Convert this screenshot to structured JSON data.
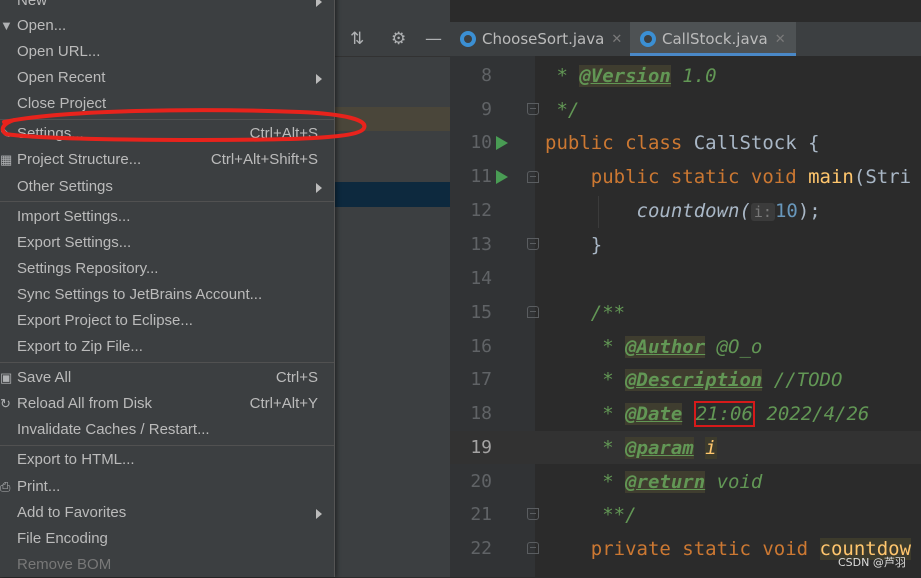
{
  "file_menu": {
    "items": [
      {
        "label": "New",
        "shortcut": "",
        "submenu": true,
        "disabled": false,
        "icon": ""
      },
      {
        "label": "Open...",
        "shortcut": "",
        "submenu": false,
        "disabled": false,
        "icon": "folder-icon"
      },
      {
        "label": "Open URL...",
        "shortcut": "",
        "submenu": false,
        "disabled": false,
        "icon": ""
      },
      {
        "label": "Open Recent",
        "shortcut": "",
        "submenu": true,
        "disabled": false,
        "icon": ""
      },
      {
        "label": "Close Project",
        "shortcut": "",
        "submenu": false,
        "disabled": false,
        "icon": ""
      },
      {
        "label": "Settings...",
        "shortcut": "Ctrl+Alt+S",
        "submenu": false,
        "disabled": false,
        "icon": "wrench-icon"
      },
      {
        "label": "Project Structure...",
        "shortcut": "Ctrl+Alt+Shift+S",
        "submenu": false,
        "disabled": false,
        "icon": "project-structure-icon"
      },
      {
        "label": "Other Settings",
        "shortcut": "",
        "submenu": true,
        "disabled": false,
        "icon": ""
      },
      {
        "label": "Import Settings...",
        "shortcut": "",
        "submenu": false,
        "disabled": false,
        "icon": ""
      },
      {
        "label": "Export Settings...",
        "shortcut": "",
        "submenu": false,
        "disabled": false,
        "icon": ""
      },
      {
        "label": "Settings Repository...",
        "shortcut": "",
        "submenu": false,
        "disabled": false,
        "icon": ""
      },
      {
        "label": "Sync Settings to JetBrains Account...",
        "shortcut": "",
        "submenu": false,
        "disabled": false,
        "icon": ""
      },
      {
        "label": "Export Project to Eclipse...",
        "shortcut": "",
        "submenu": false,
        "disabled": false,
        "icon": ""
      },
      {
        "label": "Export to Zip File...",
        "shortcut": "",
        "submenu": false,
        "disabled": false,
        "icon": ""
      },
      {
        "label": "Save All",
        "shortcut": "Ctrl+S",
        "submenu": false,
        "disabled": false,
        "icon": "save-icon"
      },
      {
        "label": "Reload All from Disk",
        "shortcut": "Ctrl+Alt+Y",
        "submenu": false,
        "disabled": false,
        "icon": "reload-icon"
      },
      {
        "label": "Invalidate Caches / Restart...",
        "shortcut": "",
        "submenu": false,
        "disabled": false,
        "icon": ""
      },
      {
        "label": "Export to HTML...",
        "shortcut": "",
        "submenu": false,
        "disabled": false,
        "icon": ""
      },
      {
        "label": "Print...",
        "shortcut": "",
        "submenu": false,
        "disabled": false,
        "icon": "print-icon"
      },
      {
        "label": "Add to Favorites",
        "shortcut": "",
        "submenu": true,
        "disabled": false,
        "icon": ""
      },
      {
        "label": "File Encoding",
        "shortcut": "",
        "submenu": false,
        "disabled": false,
        "icon": ""
      },
      {
        "label": "Remove BOM",
        "shortcut": "",
        "submenu": false,
        "disabled": true,
        "icon": ""
      }
    ]
  },
  "tabs": [
    {
      "label": "ChooseSort.java",
      "active": false
    },
    {
      "label": "CallStock.java",
      "active": true
    }
  ],
  "editor": {
    "line_numbers": [
      "8",
      "9",
      "10",
      "11",
      "12",
      "13",
      "14",
      "15",
      "16",
      "17",
      "18",
      "19",
      "20",
      "21",
      "22"
    ],
    "current_line": "19",
    "code": {
      "l8_star": " * ",
      "l8_tag": "@Version",
      "l8_rest": " 1.0",
      "l9": " */",
      "l10_kw": "public class ",
      "l10_rest": "CallStock {",
      "l11_kw": "    public static void ",
      "l11_fn": "main",
      "l11_rest": "(Stri",
      "l12_call": "        countdown(",
      "l12_hint": "i:",
      "l12_num": "10",
      "l12_end": ");",
      "l13": "    }",
      "l15": "    /**",
      "l16_star": "     * ",
      "l16_tag": "@Author",
      "l16_rest": " @O_o",
      "l17_star": "     * ",
      "l17_tag": "@Description",
      "l17_rest": " //TODO",
      "l18_star": "     * ",
      "l18_tag": "@Date",
      "l18_time": "21:06",
      "l18_rest": " 2022/4/26",
      "l19_star": "     * ",
      "l19_tag": "@param",
      "l19_rest": "i",
      "l20_star": "     * ",
      "l20_tag": "@return",
      "l20_rest": " void",
      "l21": "     **/",
      "l22_kw": "    private static void ",
      "l22_fn": "countdow"
    }
  },
  "watermark": "CSDN @芦羽",
  "colors": {
    "annotation_red": "#e8231c",
    "accent_blue": "#4a88c7"
  }
}
